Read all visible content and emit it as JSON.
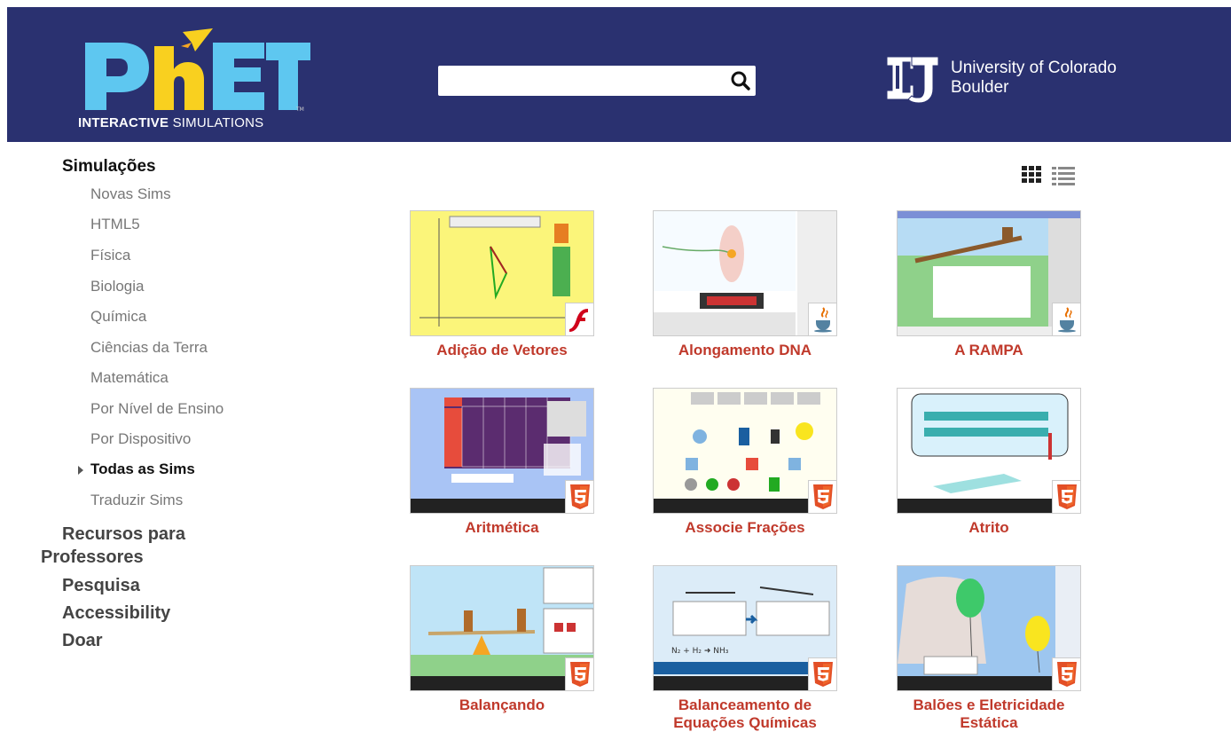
{
  "header": {
    "logo_text": "PhET",
    "logo_sub_bold": "INTERACTIVE",
    "logo_sub_rest": "SIMULATIONS",
    "search": {
      "value": "",
      "placeholder": ""
    },
    "university_line1": "University of Colorado",
    "university_line2": "Boulder"
  },
  "sidebar": {
    "heading": "Simulações",
    "items": [
      {
        "label": "Novas Sims"
      },
      {
        "label": "HTML5"
      },
      {
        "label": "Física"
      },
      {
        "label": "Biologia"
      },
      {
        "label": "Química"
      },
      {
        "label": "Ciências da Terra"
      },
      {
        "label": "Matemática"
      },
      {
        "label": "Por Nível de Ensino"
      },
      {
        "label": "Por Dispositivo"
      },
      {
        "label": "Todas as Sims"
      },
      {
        "label": "Traduzir Sims"
      }
    ],
    "sections": [
      {
        "line1": "Recursos para",
        "line2": "Professores"
      },
      {
        "line1": "Pesquisa"
      },
      {
        "line1": "Accessibility"
      },
      {
        "line1": "Doar"
      }
    ]
  },
  "view_toggle": {
    "active": "grid",
    "icons": [
      "grid-view-icon",
      "list-view-icon"
    ]
  },
  "colors": {
    "header_bg": "#2a3170",
    "title_red": "#c0392b",
    "phet_cyan": "#5ec7f0",
    "phet_yellow": "#f9d01f"
  },
  "sims": [
    {
      "title": "Adição de Vetores",
      "tech": "flash"
    },
    {
      "title": "Alongamento DNA",
      "tech": "java"
    },
    {
      "title": "A RAMPA",
      "tech": "java"
    },
    {
      "title": "Aritmética",
      "tech": "html5"
    },
    {
      "title": "Associe Frações",
      "tech": "html5"
    },
    {
      "title": "Atrito",
      "tech": "html5"
    },
    {
      "title": "Balançando",
      "tech": "html5"
    },
    {
      "title_line1": "Balanceamento de",
      "title_line2": "Equações Químicas",
      "tech": "html5"
    },
    {
      "title_line1": "Balões e Eletricidade",
      "title_line2": "Estática",
      "tech": "html5"
    }
  ]
}
